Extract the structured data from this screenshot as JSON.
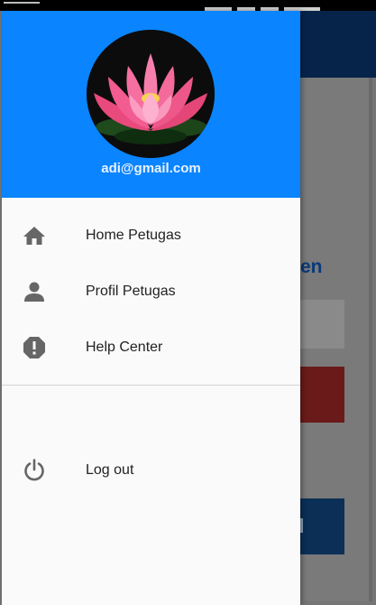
{
  "drawer": {
    "header": {
      "account_email": "adi@gmail.com",
      "avatar_icon": "lotus-flower-photo"
    },
    "menu_items": [
      {
        "label": "Home Petugas",
        "icon": "home-icon"
      },
      {
        "label": "Profil Petugas",
        "icon": "person-icon"
      },
      {
        "label": "Help Center",
        "icon": "alert-octagon-icon"
      }
    ],
    "footer_items": [
      {
        "label": "Log out",
        "icon": "power-icon"
      }
    ]
  },
  "background": {
    "heading_fragment": "en"
  },
  "colors": {
    "header_blue": "#0a84ff",
    "app_bar_dark_blue": "#06244a",
    "icon_gray": "#666666"
  }
}
